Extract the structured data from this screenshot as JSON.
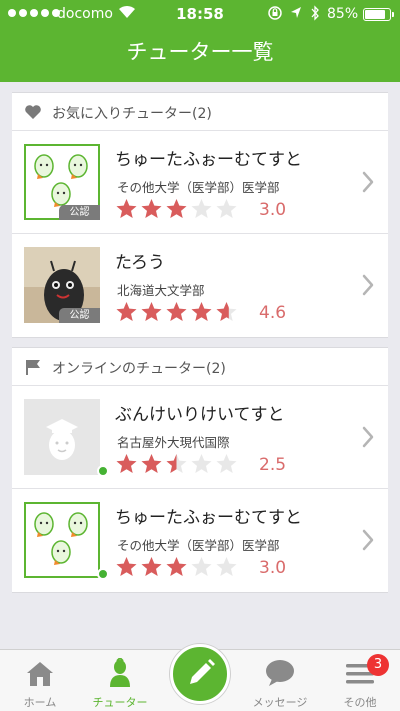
{
  "status_bar": {
    "carrier": "docomo",
    "time": "18:58",
    "battery_percent": "85%",
    "battery_level": 0.85
  },
  "nav": {
    "title": "チューター一覧"
  },
  "favorites": {
    "title": "お気に入りチューター(2)",
    "tutors": [
      {
        "name": "ちゅーたふぉーむてすと",
        "school": "その他大学（医学部）医学部",
        "rating": "3.0",
        "stars": 3.0,
        "badge": "公認",
        "avatar": "egg-pattern",
        "online": false
      },
      {
        "name": "たろう",
        "school": "北海道大文学部",
        "rating": "4.6",
        "stars": 4.6,
        "badge": "公認",
        "avatar": "photo",
        "online": false
      }
    ]
  },
  "online": {
    "title": "オンラインのチューター(2)",
    "tutors": [
      {
        "name": "ぶんけいりけいてすと",
        "school": "名古屋外大現代国際",
        "rating": "2.5",
        "stars": 2.5,
        "badge": "",
        "avatar": "placeholder",
        "online": true
      },
      {
        "name": "ちゅーたふぉーむてすと",
        "school": "その他大学（医学部）医学部",
        "rating": "3.0",
        "stars": 3.0,
        "badge": "",
        "avatar": "egg-pattern",
        "online": true
      }
    ]
  },
  "tabbar": {
    "home": "ホーム",
    "tutor": "チューター",
    "messages": "メッセージ",
    "more": "その他",
    "more_badge": "3"
  },
  "colors": {
    "brand": "#5cb531",
    "star_filled": "#d95c5c",
    "star_empty": "#e8e8e8",
    "rating_text": "#d96b6b",
    "online_dot": "#45b233"
  }
}
